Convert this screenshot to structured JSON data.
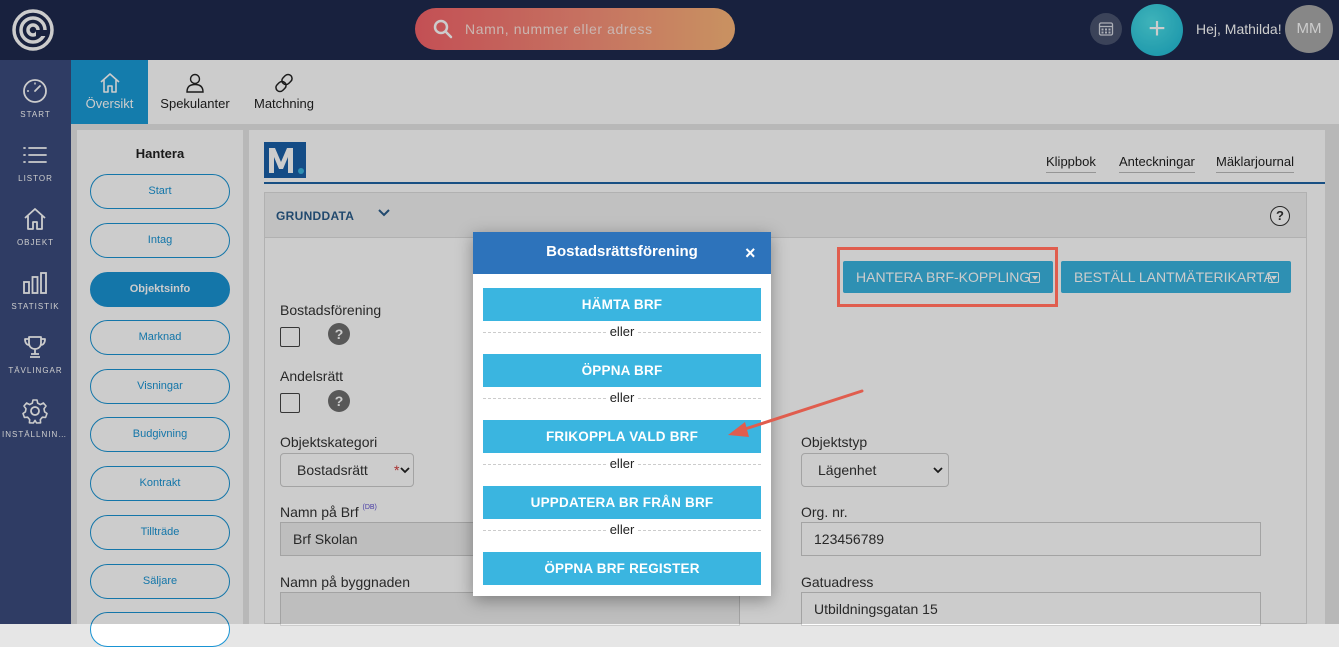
{
  "topbar": {
    "search_placeholder": "Namn, nummer eller adress",
    "greeting": "Hej, Mathilda!",
    "avatar_initials": "MM",
    "plus_label": "+"
  },
  "leftnav": {
    "items": [
      {
        "label": "START",
        "icon": "gauge-icon"
      },
      {
        "label": "LISTOR",
        "icon": "list-icon"
      },
      {
        "label": "OBJEKT",
        "icon": "home-icon"
      },
      {
        "label": "STATISTIK",
        "icon": "bar-chart-icon"
      },
      {
        "label": "TÄVLINGAR",
        "icon": "trophy-icon"
      },
      {
        "label": "INSTÄLLNINGAR",
        "icon": "gear-icon"
      }
    ]
  },
  "subtabs": [
    {
      "label": "Översikt",
      "icon": "home-icon"
    },
    {
      "label": "Spekulanter",
      "icon": "users-icon"
    },
    {
      "label": "Matchning",
      "icon": "link-icon"
    }
  ],
  "sidepanel": {
    "title": "Hantera",
    "items": [
      "Start",
      "Intag",
      "Objektsinfo",
      "Marknad",
      "Visningar",
      "Budgivning",
      "Kontrakt",
      "Tillträde",
      "Säljare",
      ""
    ],
    "active": "Objektsinfo"
  },
  "main": {
    "links": [
      "Klippbok",
      "Anteckningar",
      "Mäklarjournal"
    ],
    "section_title": "GRUNDDATA",
    "help": "?",
    "btn_hantera": "HANTERA BRF-KOPPLING",
    "btn_bestall": "BESTÄLL LANTMÄTERIKARTA"
  },
  "form": {
    "bostadsforening_label": "Bostadsförening",
    "andelsratt_label": "Andelsrätt",
    "objektskategori_label": "Objektskategori",
    "objektskategori_value": "Bostadsrätt",
    "required_mark": "*",
    "objektstyp_label": "Objektstyp",
    "objektstyp_value": "Lägenhet",
    "namn_brf_label": "Namn på Brf",
    "namn_brf_badge": "(DB)",
    "namn_brf_value": "Brf Skolan",
    "org_nr_label": "Org. nr.",
    "org_nr_value": "123456789",
    "namn_byggnad_label": "Namn på byggnaden",
    "namn_byggnad_value": "",
    "gatuadress_label": "Gatuadress",
    "gatuadress_value": "Utbildningsgatan 15"
  },
  "modal": {
    "title": "Bostadsrättsförening",
    "close": "×",
    "buttons": [
      "HÄMTA BRF",
      "ÖPPNA BRF",
      "FRIKOPPLA VALD BRF",
      "UPPDATERA BR FRÅN BRF",
      "ÖPPNA BRF REGISTER"
    ],
    "separator": "eller"
  },
  "colors": {
    "topbar": "#1e2a4e",
    "leftnav": "#3b4c7e",
    "accent": "#199bd8",
    "modal_header": "#2d73bb",
    "button": "#3ab5e0",
    "annotation": "#e05d4e"
  }
}
